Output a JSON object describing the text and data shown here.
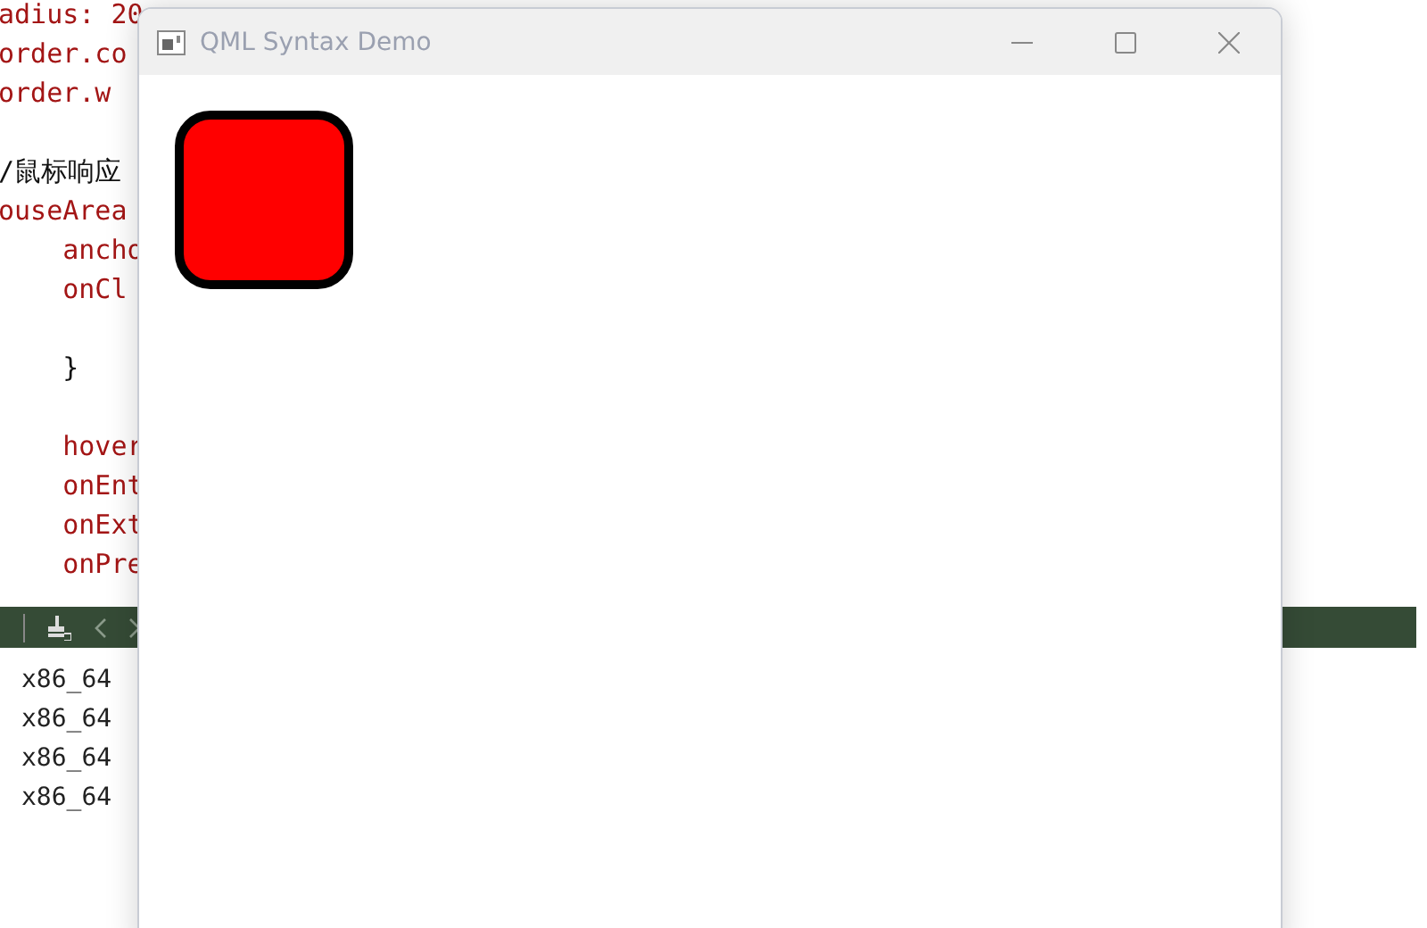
{
  "editor": {
    "code_lines": [
      {
        "kind": "code",
        "text": "adius: 20"
      },
      {
        "kind": "code",
        "text": "order.co"
      },
      {
        "kind": "code",
        "text": "order.w"
      },
      {
        "kind": "blank"
      },
      {
        "kind": "comment",
        "text": "/鼠标响应"
      },
      {
        "kind": "code",
        "text": "ouseArea"
      },
      {
        "kind": "code",
        "text": "    ancho"
      },
      {
        "kind": "code",
        "text": "    onCl"
      },
      {
        "kind": "blank"
      },
      {
        "kind": "plain",
        "text": "    }"
      },
      {
        "kind": "blank"
      },
      {
        "kind": "code",
        "text": "    hover"
      },
      {
        "kind": "code",
        "text": "    onEnt"
      },
      {
        "kind": "code",
        "text": "    onExt"
      },
      {
        "kind": "code",
        "text": "    onPre"
      }
    ]
  },
  "output": {
    "lines": [
      "x86_64",
      "x86_64",
      "x86_64",
      "x86_64"
    ]
  },
  "window": {
    "title": "QML Syntax Demo"
  }
}
